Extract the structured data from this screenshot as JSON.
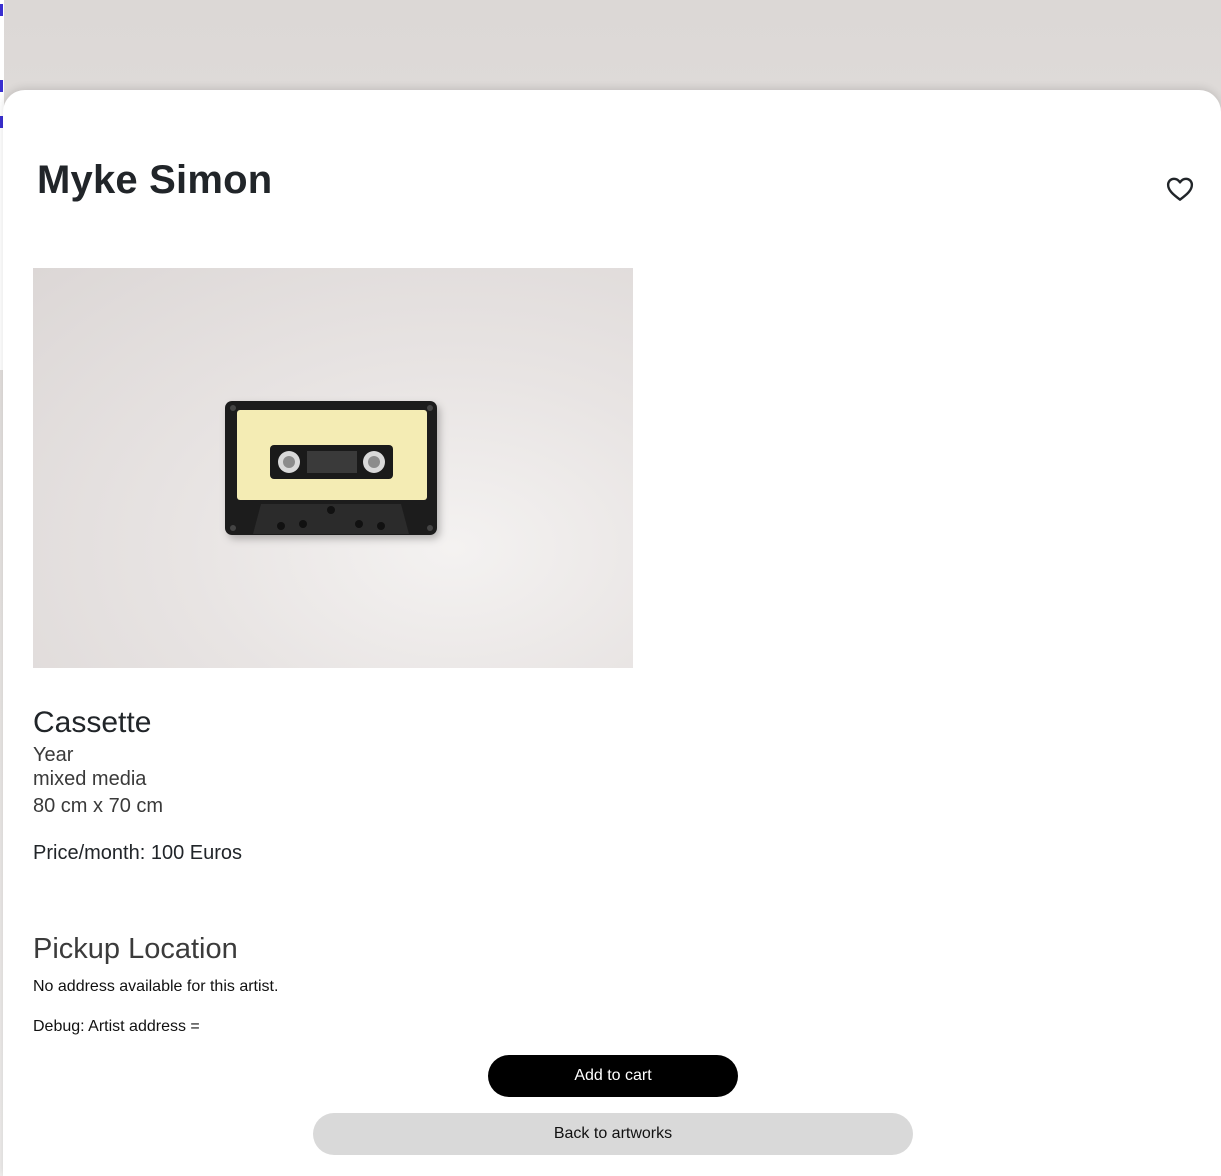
{
  "artist": {
    "name": "Myke Simon"
  },
  "favorite_icon": "heart-outline-icon",
  "artwork": {
    "image_icon": "cassette-tape-photo",
    "title": "Cassette",
    "year": "Year",
    "medium": "mixed media",
    "dimensions": "80 cm x 70 cm",
    "price_label": "Price/month: 100 Euros"
  },
  "pickup": {
    "heading": "Pickup Location",
    "no_address": "No address available for this artist.",
    "debug": "Debug: Artist address ="
  },
  "actions": {
    "add_to_cart": "Add to cart",
    "back": "Back to artworks"
  },
  "colors": {
    "primary_button": "#000000",
    "secondary_button": "#d9d9d9",
    "text": "#212529"
  }
}
